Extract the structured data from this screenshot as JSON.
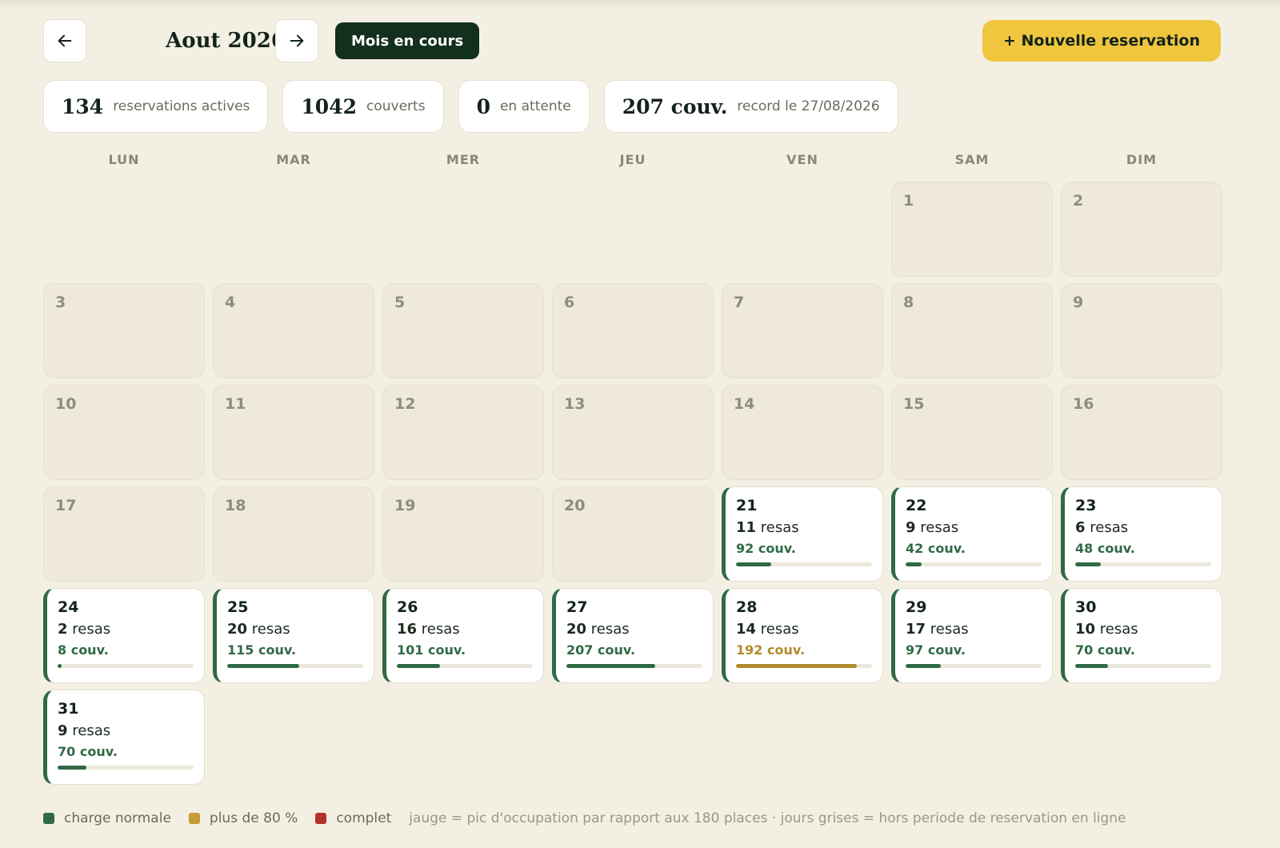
{
  "header": {
    "prev_icon": "arrow-left-icon",
    "next_icon": "arrow-right-icon",
    "month_title": "Aout 2026",
    "current_month_label": "Mois en cours",
    "new_reservation_label": "+ Nouvelle reservation"
  },
  "stats": [
    {
      "value": "134",
      "label": "reservations actives"
    },
    {
      "value": "1042",
      "label": "couverts"
    },
    {
      "value": "0",
      "label": "en attente"
    },
    {
      "value": "207 couv.",
      "label": "record le 27/08/2026"
    }
  ],
  "weekdays": [
    "LUN",
    "MAR",
    "MER",
    "JEU",
    "VEN",
    "SAM",
    "DIM"
  ],
  "calendar": {
    "first_weekday_index": 5,
    "capacity": 180,
    "days": [
      {
        "day": "1"
      },
      {
        "day": "2"
      },
      {
        "day": "3"
      },
      {
        "day": "4"
      },
      {
        "day": "5"
      },
      {
        "day": "6"
      },
      {
        "day": "7"
      },
      {
        "day": "8"
      },
      {
        "day": "9"
      },
      {
        "day": "10"
      },
      {
        "day": "11"
      },
      {
        "day": "12"
      },
      {
        "day": "13"
      },
      {
        "day": "14"
      },
      {
        "day": "15"
      },
      {
        "day": "16"
      },
      {
        "day": "17"
      },
      {
        "day": "18"
      },
      {
        "day": "19"
      },
      {
        "day": "20"
      },
      {
        "day": "21",
        "resas": "11",
        "couv": "92 couv.",
        "peak_pct": 26,
        "status": "normal"
      },
      {
        "day": "22",
        "resas": "9",
        "couv": "42 couv.",
        "peak_pct": 12,
        "status": "normal"
      },
      {
        "day": "23",
        "resas": "6",
        "couv": "48 couv.",
        "peak_pct": 19,
        "status": "normal"
      },
      {
        "day": "24",
        "resas": "2",
        "couv": "8 couv.",
        "peak_pct": 3,
        "status": "normal"
      },
      {
        "day": "25",
        "resas": "20",
        "couv": "115 couv.",
        "peak_pct": 53,
        "status": "normal"
      },
      {
        "day": "26",
        "resas": "16",
        "couv": "101 couv.",
        "peak_pct": 32,
        "status": "normal"
      },
      {
        "day": "27",
        "resas": "20",
        "couv": "207 couv.",
        "peak_pct": 65,
        "status": "normal"
      },
      {
        "day": "28",
        "resas": "14",
        "couv": "192 couv.",
        "peak_pct": 89,
        "status": "warn"
      },
      {
        "day": "29",
        "resas": "17",
        "couv": "97 couv.",
        "peak_pct": 26,
        "status": "normal"
      },
      {
        "day": "30",
        "resas": "10",
        "couv": "70 couv.",
        "peak_pct": 24,
        "status": "normal"
      },
      {
        "day": "31",
        "resas": "9",
        "couv": "70 couv.",
        "peak_pct": 21,
        "status": "normal"
      }
    ],
    "resas_word": "resas"
  },
  "legend": {
    "items": [
      {
        "label": "charge normale",
        "color": "#2f6a45"
      },
      {
        "label": "plus de 80 %",
        "color": "#c79a32"
      },
      {
        "label": "complet",
        "color": "#b3322c"
      }
    ],
    "note": "jauge = pic d'occupation par rapport aux 180 places · jours grises = hors periode de reservation en ligne"
  },
  "colors": {
    "normal": "#2f6a45",
    "warn": "#b18a2c",
    "accent": "#efc63e",
    "dark": "#13301f"
  }
}
